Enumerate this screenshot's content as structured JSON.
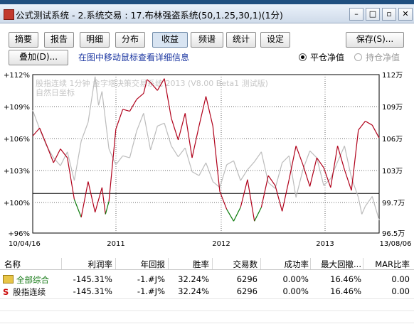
{
  "window": {
    "title": "公式测试系统 - 2.系统交易 : 17.布林强盗系统(50,1.25,30,1)(1分)"
  },
  "tabs": [
    {
      "label": "摘要"
    },
    {
      "label": "报告"
    },
    {
      "label": "明细"
    },
    {
      "label": "分布"
    },
    {
      "label": "收益"
    },
    {
      "label": "频谱"
    },
    {
      "label": "统计"
    },
    {
      "label": "设定"
    }
  ],
  "active_tab": "收益",
  "toolbar": {
    "save_label": "保存(S)...",
    "overlay_label": "叠加(D)...",
    "hint": "在图中移动鼠标查看详细信息",
    "radio_flat": "平仓净值",
    "radio_hold": "持仓净值"
  },
  "chart_data": {
    "type": "line",
    "watermark_line1": "股指连续 1分钟 金字塔决策交易系统 2013 (V8.00 Beta1 测试版)",
    "watermark_line2": "自然日坐标",
    "left_ticks": [
      "+112%",
      "+109%",
      "+106%",
      "+103%",
      "+100%",
      "+96%"
    ],
    "right_ticks": [
      "112万",
      "109万",
      "106万",
      "103万",
      "99.7万",
      "96.5万"
    ],
    "x_labels": [
      "10/04/16",
      "2011",
      "2012",
      "2013",
      "13/08/06"
    ],
    "ylim": [
      96,
      112
    ],
    "reference_value": 100,
    "series": [
      {
        "color": "#b0001a",
        "below_color": "#0a7a0a",
        "x": [
          0,
          2,
          4,
          6,
          8,
          10,
          12,
          14,
          16,
          18,
          20,
          21,
          22,
          24,
          26,
          28,
          30,
          32,
          33,
          34,
          36,
          38,
          40,
          42,
          44,
          46,
          48,
          50,
          52,
          54,
          56,
          58,
          60,
          62,
          64,
          66,
          68,
          70,
          72,
          74,
          76,
          78,
          80,
          82,
          84,
          86,
          88,
          90,
          92,
          94,
          96,
          98,
          100
        ],
        "y": [
          105.8,
          106.6,
          104.9,
          103.1,
          104.5,
          103.6,
          99.4,
          97.6,
          101.2,
          98.1,
          100.6,
          97.9,
          99.2,
          106.5,
          108.5,
          108.3,
          109.5,
          110.1,
          111.5,
          111.2,
          110.4,
          111.6,
          107.6,
          105.4,
          108.1,
          103.6,
          106.8,
          109.8,
          106.8,
          100.2,
          98.4,
          97.2,
          98.6,
          101.4,
          97.2,
          98.6,
          101.8,
          100.8,
          98.2,
          101.4,
          104.8,
          102.9,
          100.7,
          103.6,
          102.6,
          100.6,
          104.8,
          102.4,
          100.3,
          106.4,
          107.3,
          106.9,
          105.6
        ]
      },
      {
        "color": "#bcbcbc",
        "x": [
          0,
          2,
          4,
          6,
          8,
          10,
          12,
          14,
          16,
          18,
          19,
          20,
          22,
          24,
          26,
          28,
          30,
          32,
          34,
          36,
          38,
          40,
          42,
          44,
          46,
          48,
          50,
          52,
          54,
          56,
          58,
          60,
          62,
          64,
          66,
          68,
          70,
          72,
          74,
          76,
          78,
          80,
          82,
          84,
          86,
          88,
          90,
          92,
          94,
          95,
          96,
          98,
          100
        ],
        "y": [
          108.4,
          106.5,
          104.8,
          103.6,
          102.8,
          104.2,
          101.3,
          105.3,
          107.2,
          111.8,
          108.9,
          110.3,
          104.5,
          102.9,
          103.8,
          103.6,
          106.3,
          108.1,
          104.4,
          106.8,
          107.1,
          104.8,
          103.7,
          104.6,
          102.2,
          101.8,
          103.1,
          101.2,
          100.6,
          102.9,
          103.3,
          101.3,
          102.4,
          103.2,
          104.2,
          101.1,
          100.5,
          103.1,
          103.8,
          99.6,
          102.4,
          104.3,
          103.6,
          100.8,
          101.5,
          103.2,
          104.8,
          101.6,
          99.6,
          97.9,
          98.7,
          99.7,
          97.3
        ]
      }
    ]
  },
  "table": {
    "headers": [
      "名称",
      "利润率",
      "年回报",
      "胜率",
      "交易数",
      "成功率",
      "最大回撤...",
      "MAR比率"
    ],
    "rows": [
      {
        "name": "全部综合",
        "profit": "-145.31%",
        "annual": "-1.#J%",
        "winrate": "32.24%",
        "trades": "6296",
        "success": "0.00%",
        "drawdown": "16.46%",
        "mar": "0.00"
      },
      {
        "name": "股指连续",
        "profit": "-145.31%",
        "annual": "-1.#J%",
        "winrate": "32.24%",
        "trades": "6296",
        "success": "0.00%",
        "drawdown": "16.46%",
        "mar": "0.00"
      }
    ]
  }
}
